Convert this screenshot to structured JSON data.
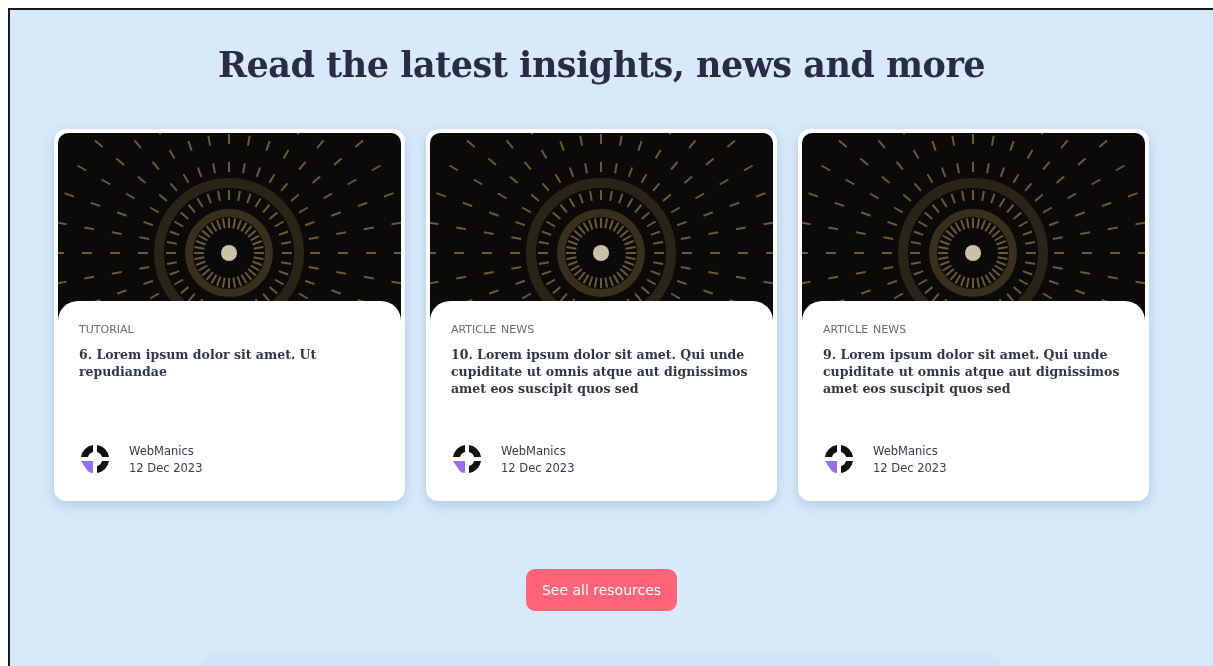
{
  "heading": "Read the latest insights, news and more",
  "cards": [
    {
      "tags": [
        "TUTORIAL"
      ],
      "title": "6. Lorem ipsum dolor sit amet. Ut repudiandae",
      "author": "WebManics",
      "date": "12 Dec 2023"
    },
    {
      "tags": [
        "ARTICLE",
        "NEWS"
      ],
      "title": "10. Lorem ipsum dolor sit amet. Qui unde cupiditate ut omnis atque aut dignissimos amet eos suscipit quos sed",
      "author": "WebManics",
      "date": "12 Dec 2023"
    },
    {
      "tags": [
        "ARTICLE",
        "NEWS"
      ],
      "title": "9. Lorem ipsum dolor sit amet. Qui unde cupiditate ut omnis atque aut dignissimos amet eos suscipit quos sed",
      "author": "WebManics",
      "date": "12 Dec 2023"
    }
  ],
  "button": "See all resources"
}
